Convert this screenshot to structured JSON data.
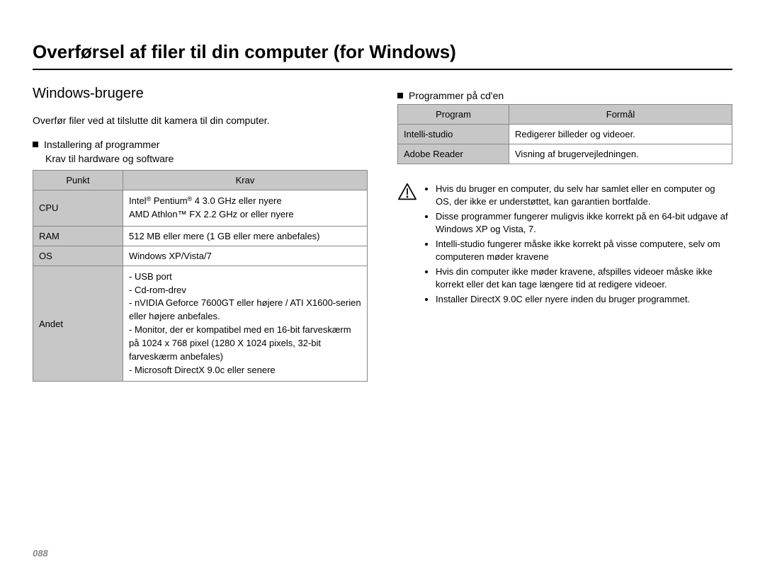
{
  "title": "Overførsel af filer til din computer (for Windows)",
  "subtitle": "Windows-brugere",
  "intro": "Overfør filer ved at tilslutte dit kamera til din computer.",
  "install": {
    "heading": "Installering af programmer",
    "sub": "Krav til hardware og software",
    "headers": [
      "Punkt",
      "Krav"
    ],
    "rows": [
      {
        "label": "CPU",
        "value": "Intel® Pentium® 4 3.0 GHz eller nyere\nAMD Athlon™ FX 2.2 GHz or eller nyere"
      },
      {
        "label": "RAM",
        "value": "512 MB eller mere (1 GB eller mere anbefales)"
      },
      {
        "label": "OS",
        "value": "Windows XP/Vista/7"
      },
      {
        "label": "Andet",
        "value": "- USB port\n- Cd-rom-drev\n- nVIDIA Geforce 7600GT eller højere / ATI X1600-serien eller højere anbefales.\n- Monitor, der er kompatibel med en 16-bit farveskærm på 1024 x 768 pixel (1280 X 1024 pixels, 32-bit farveskærm anbefales)\n- Microsoft DirectX 9.0c eller senere"
      }
    ]
  },
  "programs": {
    "heading": "Programmer på cd'en",
    "headers": [
      "Program",
      "Formål"
    ],
    "rows": [
      {
        "label": "Intelli-studio",
        "value": "Redigerer billeder og videoer."
      },
      {
        "label": "Adobe Reader",
        "value": "Visning af brugervejledningen."
      }
    ]
  },
  "notice": [
    "Hvis du bruger en computer, du selv har samlet eller en computer og OS, der ikke er understøttet, kan garantien bortfalde.",
    "Disse programmer fungerer muligvis ikke korrekt på en 64-bit udgave af Windows XP og Vista, 7.",
    "Intelli-studio fungerer måske ikke korrekt på visse computere, selv om computeren møder kravene",
    "Hvis din computer ikke møder kravene, afspilles videoer måske ikke korrekt eller det kan tage længere tid at redigere videoer.",
    "Installer DirectX 9.0C eller nyere inden du bruger programmet."
  ],
  "page_number": "088"
}
